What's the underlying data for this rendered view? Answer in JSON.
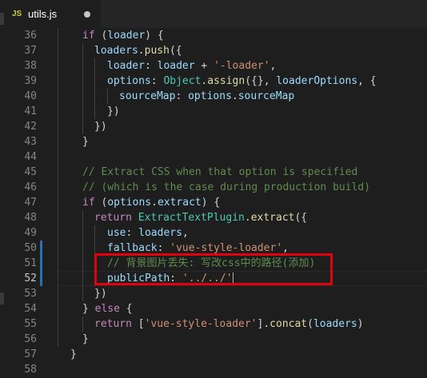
{
  "tab": {
    "icon_text": "JS",
    "filename": "utils.js"
  },
  "lines": [
    {
      "num": "36"
    },
    {
      "num": "37"
    },
    {
      "num": "38"
    },
    {
      "num": "39"
    },
    {
      "num": "40"
    },
    {
      "num": "41"
    },
    {
      "num": "42"
    },
    {
      "num": "43"
    },
    {
      "num": "44"
    },
    {
      "num": "45"
    },
    {
      "num": "46"
    },
    {
      "num": "47"
    },
    {
      "num": "48"
    },
    {
      "num": "49"
    },
    {
      "num": "50"
    },
    {
      "num": "51"
    },
    {
      "num": "52"
    },
    {
      "num": "53"
    },
    {
      "num": "54"
    },
    {
      "num": "55"
    },
    {
      "num": "56"
    },
    {
      "num": "57"
    },
    {
      "num": "58"
    }
  ],
  "code": {
    "l36": {
      "kw": "if",
      "open": " (",
      "var": "loader",
      "close": ") {"
    },
    "l37": {
      "obj": "loaders",
      "dot": ".",
      "fn": "push",
      "rest": "({"
    },
    "l38": {
      "key": "loader",
      "colon": ": ",
      "var": "loader",
      "plus": " + ",
      "str": "'-loader'",
      "comma": ","
    },
    "l39": {
      "key": "options",
      "colon": ": ",
      "cls": "Object",
      "dot": ".",
      "fn": "assign",
      "open": "({}, ",
      "var": "loaderOptions",
      "rest": ", {"
    },
    "l40": {
      "key": "sourceMap",
      "colon": ": ",
      "obj": "options",
      "dot": ".",
      "prop": "sourceMap"
    },
    "l41": {
      "text": "})"
    },
    "l42": {
      "text": "})"
    },
    "l43": {
      "text": "}"
    },
    "l45": {
      "comment": "// Extract CSS when that option is specified"
    },
    "l46": {
      "comment": "// (which is the case during production build)"
    },
    "l47": {
      "kw": "if",
      "open": " (",
      "obj": "options",
      "dot": ".",
      "prop": "extract",
      "close": ") {"
    },
    "l48": {
      "kw": "return",
      "sp": " ",
      "cls": "ExtractTextPlugin",
      "dot": ".",
      "fn": "extract",
      "rest": "({"
    },
    "l49": {
      "key": "use",
      "colon": ": ",
      "var": "loaders",
      "comma": ","
    },
    "l50": {
      "key": "fallback",
      "colon": ": ",
      "str": "'vue-style-loader'",
      "comma": ","
    },
    "l51": {
      "comment": "// 背景图片丢失: 写改css中的路径(添加)"
    },
    "l52": {
      "key": "publicPath",
      "colon": ": ",
      "str": "'../../'"
    },
    "l53": {
      "text": "})"
    },
    "l54": {
      "pre": "} ",
      "kw": "else",
      "post": " {"
    },
    "l55": {
      "kw": "return",
      "sp": " ",
      "open": "[",
      "str": "'vue-style-loader'",
      "mid": "].",
      "fn": "concat",
      "po": "(",
      "var": "loaders",
      "pc": ")"
    },
    "l56": {
      "text": "}"
    },
    "l57": {
      "text": "}"
    }
  },
  "colors": {
    "background": "#1e1e1e",
    "highlight_box": "#e2000f",
    "modified_bar": "#2a6fb0"
  }
}
